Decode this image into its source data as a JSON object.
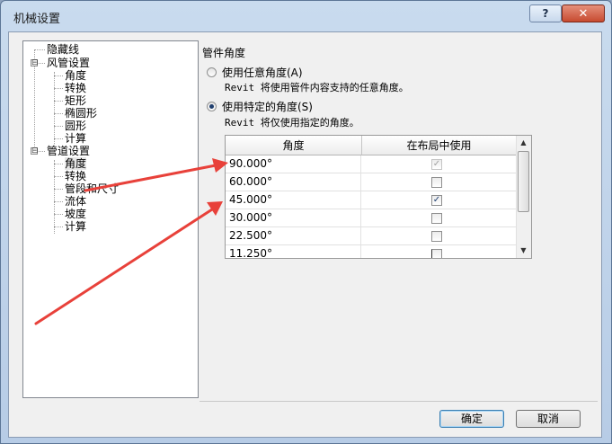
{
  "window": {
    "title": "机械设置",
    "help_label": "?",
    "close_label": "✕"
  },
  "tree": {
    "items": [
      {
        "label": "隐藏线"
      },
      {
        "label": "风管设置",
        "expander": "⊟"
      },
      {
        "label": "角度"
      },
      {
        "label": "转换"
      },
      {
        "label": "矩形"
      },
      {
        "label": "椭圆形"
      },
      {
        "label": "圆形"
      },
      {
        "label": "计算"
      },
      {
        "label": "管道设置",
        "expander": "⊟"
      },
      {
        "label": "角度",
        "selected": true
      },
      {
        "label": "转换"
      },
      {
        "label": "管段和尺寸"
      },
      {
        "label": "流体"
      },
      {
        "label": "坡度"
      },
      {
        "label": "计算"
      }
    ]
  },
  "panel": {
    "group_title": "管件角度",
    "option_any": {
      "label": "使用任意角度(A)",
      "desc": "Revit 将使用管件内容支持的任意角度。"
    },
    "option_specific": {
      "label": "使用特定的角度(S)",
      "desc": "Revit 将仅使用指定的角度。",
      "selected": true
    },
    "grid": {
      "col_angle": "角度",
      "col_use": "在布局中使用",
      "rows": [
        {
          "angle": "90.000°",
          "use": "checked-disabled"
        },
        {
          "angle": "60.000°",
          "use": "unchecked"
        },
        {
          "angle": "45.000°",
          "use": "checked"
        },
        {
          "angle": "30.000°",
          "use": "unchecked"
        },
        {
          "angle": "22.500°",
          "use": "unchecked"
        },
        {
          "angle": "11.250°",
          "use": "unchecked"
        }
      ]
    }
  },
  "buttons": {
    "ok": "确定",
    "cancel": "取消"
  },
  "colors": {
    "annotation_arrow": "#e8413a",
    "title_bar": "#c9dbee",
    "close_button": "#c74a30"
  }
}
